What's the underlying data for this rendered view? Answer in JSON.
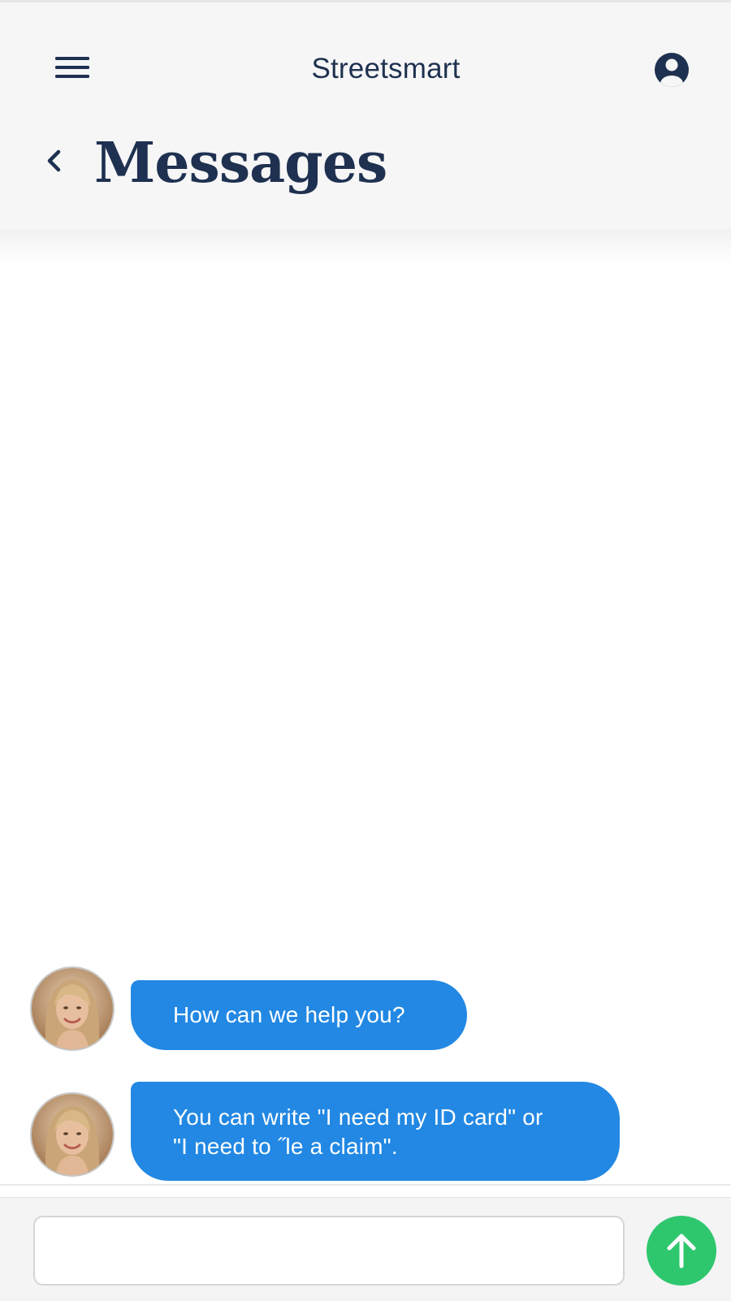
{
  "app": {
    "title": "Streetsmart"
  },
  "header": {
    "menu_icon": "hamburger-menu-icon",
    "account_icon": "user-circle-icon",
    "back_icon": "chevron-left-icon",
    "page_title": "Messages"
  },
  "messages": [
    {
      "sender": "agent",
      "avatar_icon": "agent-avatar-photo",
      "text": "How can we help you?"
    },
    {
      "sender": "agent",
      "avatar_icon": "agent-avatar-photo",
      "line1": "You can write \"I need my ID card\" or",
      "line2": "\"I need to ˝le a claim\"."
    }
  ],
  "composer": {
    "value": "",
    "placeholder": "",
    "send_icon": "arrow-up-icon"
  },
  "colors": {
    "header_background": "#f6f6f7",
    "navy_text": "#1f3150",
    "bubble_blue": "#2288e3",
    "send_green": "#2ec76e"
  }
}
